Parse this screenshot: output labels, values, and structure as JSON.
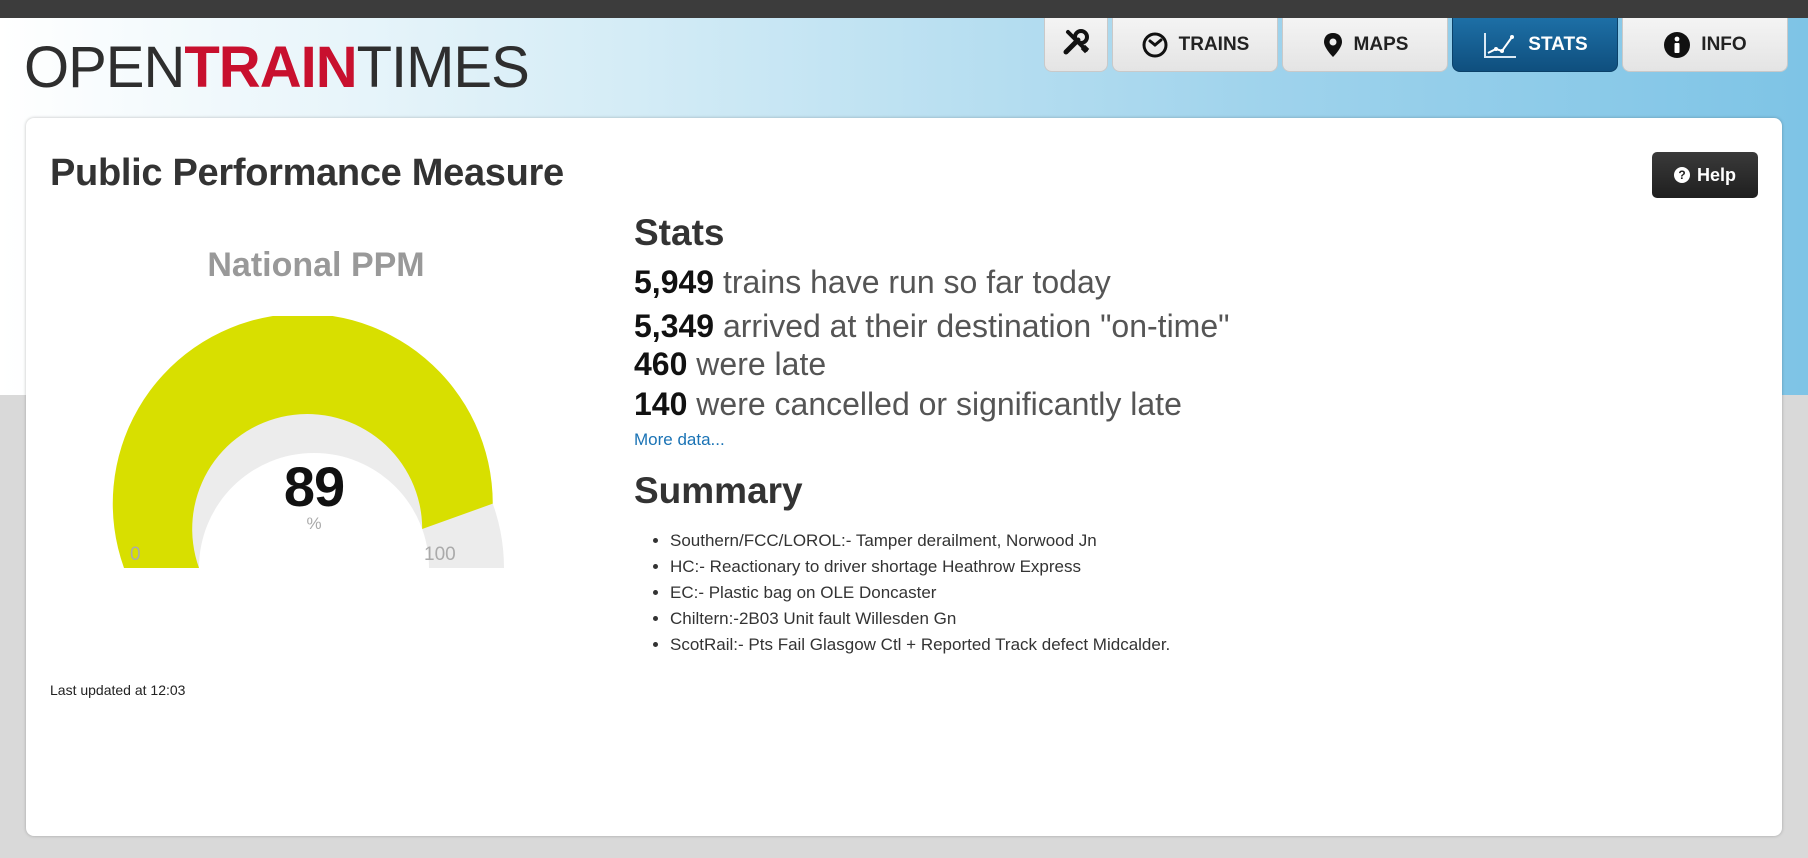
{
  "logo": {
    "part1": "OPEN",
    "part2": "TRAIN",
    "part3": "TIMES"
  },
  "nav": {
    "tools_icon": "tools-icon",
    "items": [
      {
        "label": "TRAINS",
        "icon": "clock-icon"
      },
      {
        "label": "MAPS",
        "icon": "map-pin-icon"
      },
      {
        "label": "STATS",
        "icon": "chart-icon",
        "active": true
      },
      {
        "label": "INFO",
        "icon": "info-icon"
      }
    ]
  },
  "page": {
    "title": "Public Performance Measure",
    "help_label": "Help"
  },
  "gauge": {
    "title": "National PPM",
    "value": "89",
    "unit": "%",
    "min": "0",
    "max": "100",
    "fill_color": "#d8df00",
    "track_color": "#ececec",
    "fraction": 0.89
  },
  "stats": {
    "heading": "Stats",
    "lines": [
      {
        "num": "5,949",
        "text": " trains have run so far today"
      },
      {
        "num": "5,349",
        "text": " arrived at their destination \"on-time\""
      },
      {
        "num": "460",
        "text": " were late"
      },
      {
        "num": "140",
        "text": " were cancelled or significantly late"
      }
    ],
    "more_link": "More data..."
  },
  "summary": {
    "heading": "Summary",
    "items": [
      "Southern/FCC/LOROL:- Tamper derailment, Norwood Jn",
      "HC:- Reactionary to driver shortage Heathrow Express",
      "EC:- Plastic bag on OLE Doncaster",
      "Chiltern:-2B03 Unit fault Willesden Gn",
      "ScotRail:- Pts Fail Glasgow Ctl + Reported Track defect Midcalder."
    ]
  },
  "footer": {
    "updated": "Last updated at 12:03"
  },
  "colors": {
    "accent": "#c8102e",
    "nav_active": "#155f93",
    "link": "#1a73b5"
  }
}
